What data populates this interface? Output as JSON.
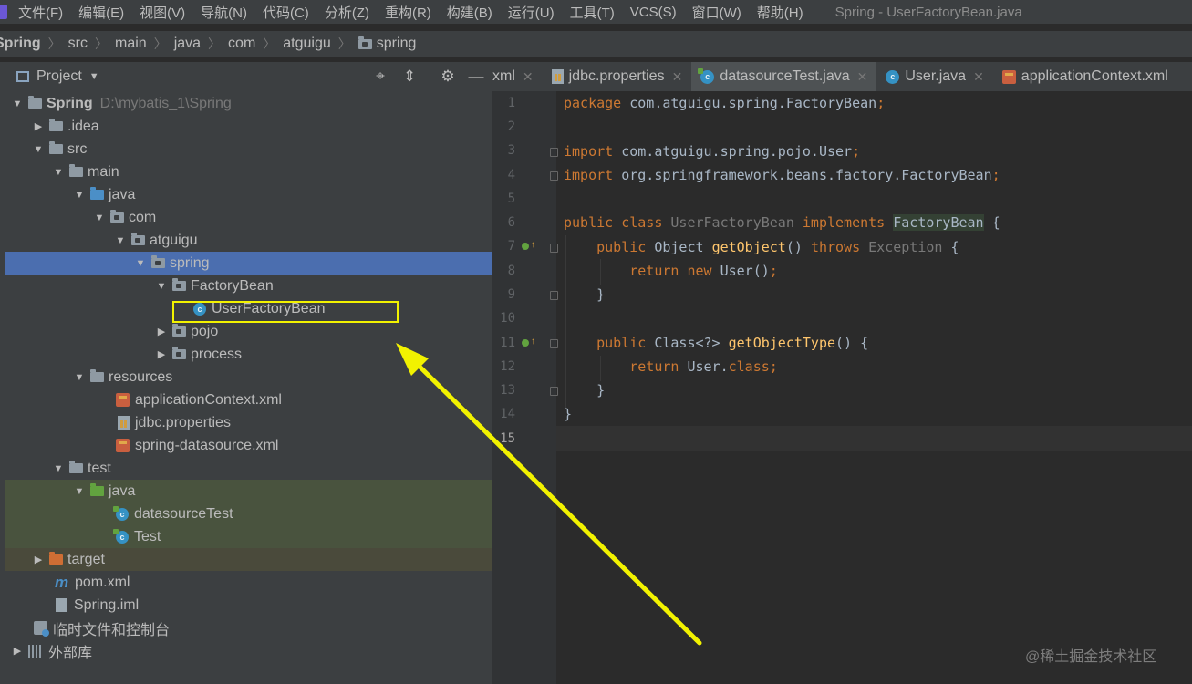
{
  "menu": [
    "文件(F)",
    "编辑(E)",
    "视图(V)",
    "导航(N)",
    "代码(C)",
    "分析(Z)",
    "重构(R)",
    "构建(B)",
    "运行(U)",
    "工具(T)",
    "VCS(S)",
    "窗口(W)",
    "帮助(H)"
  ],
  "window_title": "Spring - UserFactoryBean.java",
  "breadcrumb": [
    "Spring",
    "src",
    "main",
    "java",
    "com",
    "atguigu",
    "spring"
  ],
  "project_panel": {
    "title": "Project",
    "tree": [
      {
        "label": "Spring",
        "path": "D:\\mybatis_1\\Spring",
        "icon": "module-folder-icon",
        "expanded": true
      },
      {
        "label": ".idea",
        "icon": "folder-icon",
        "expanded": false
      },
      {
        "label": "src",
        "icon": "folder-icon",
        "expanded": true
      },
      {
        "label": "main",
        "icon": "folder-icon",
        "expanded": true
      },
      {
        "label": "java",
        "icon": "source-folder-icon",
        "expanded": true
      },
      {
        "label": "com",
        "icon": "package-icon",
        "expanded": true
      },
      {
        "label": "atguigu",
        "icon": "package-icon",
        "expanded": true
      },
      {
        "label": "spring",
        "icon": "package-icon",
        "expanded": true,
        "selected": true
      },
      {
        "label": "FactoryBean",
        "icon": "package-icon",
        "expanded": true
      },
      {
        "label": "UserFactoryBean",
        "icon": "class-icon"
      },
      {
        "label": "pojo",
        "icon": "package-icon",
        "expanded": false
      },
      {
        "label": "process",
        "icon": "package-icon",
        "expanded": false
      },
      {
        "label": "resources",
        "icon": "resources-folder-icon",
        "expanded": true
      },
      {
        "label": "applicationContext.xml",
        "icon": "xml-file-icon"
      },
      {
        "label": "jdbc.properties",
        "icon": "properties-file-icon"
      },
      {
        "label": "spring-datasource.xml",
        "icon": "xml-file-icon"
      },
      {
        "label": "test",
        "icon": "folder-icon",
        "expanded": true
      },
      {
        "label": "java",
        "icon": "test-source-folder-icon",
        "expanded": true
      },
      {
        "label": "datasourceTest",
        "icon": "test-class-icon"
      },
      {
        "label": "Test",
        "icon": "test-class-icon"
      },
      {
        "label": "target",
        "icon": "excluded-folder-icon",
        "expanded": false
      },
      {
        "label": "pom.xml",
        "icon": "maven-icon"
      },
      {
        "label": "Spring.iml",
        "icon": "iml-file-icon"
      },
      {
        "label": "临时文件和控制台",
        "icon": "scratch-icon"
      },
      {
        "label": "外部库",
        "icon": "library-icon",
        "expanded": false
      }
    ]
  },
  "tabs": [
    {
      "label": "xml",
      "icon": "xml-file-icon"
    },
    {
      "label": "jdbc.properties",
      "icon": "properties-file-icon"
    },
    {
      "label": "datasourceTest.java",
      "icon": "test-class-icon",
      "active": true
    },
    {
      "label": "User.java",
      "icon": "class-icon"
    },
    {
      "label": "applicationContext.xml",
      "icon": "xml-file-icon"
    }
  ],
  "editor": {
    "line_numbers": [
      "1",
      "2",
      "3",
      "4",
      "5",
      "6",
      "7",
      "8",
      "9",
      "10",
      "11",
      "12",
      "13",
      "14",
      "15"
    ],
    "current_line": "15",
    "code": {
      "l1_kw": "package",
      "l1_rest": " com.atguigu.spring.FactoryBean",
      "l3_kw": "import",
      "l3_rest": " com.atguigu.spring.pojo.User",
      "l4_kw": "import",
      "l4_rest": " org.springframework.beans.factory.FactoryBean",
      "l6_a": "public class",
      "l6_b": " UserFactoryBean ",
      "l6_c": "implements",
      "l6_d": " ",
      "l6_e": "FactoryBean",
      "l6_f": " {",
      "l7_a": "public",
      "l7_b": " Object ",
      "l7_c": "getObject",
      "l7_d": "() ",
      "l7_e": "throws",
      "l7_f": " Exception",
      "l7_g": " {",
      "l8_a": "return new",
      "l8_b": " User()",
      "l9": "}",
      "l11_a": "public",
      "l11_b": " Class<?> ",
      "l11_c": "getObjectType",
      "l11_d": "() {",
      "l12_a": "return",
      "l12_b": " User.",
      "l12_c": "class",
      "l13": "}",
      "l14": "}",
      "semicolon": ";"
    }
  },
  "watermark": "@稀土掘金技术社区",
  "colors": {
    "annotation": "#f2f200",
    "selection": "#4b6eaf",
    "keyword": "#cc7832"
  }
}
